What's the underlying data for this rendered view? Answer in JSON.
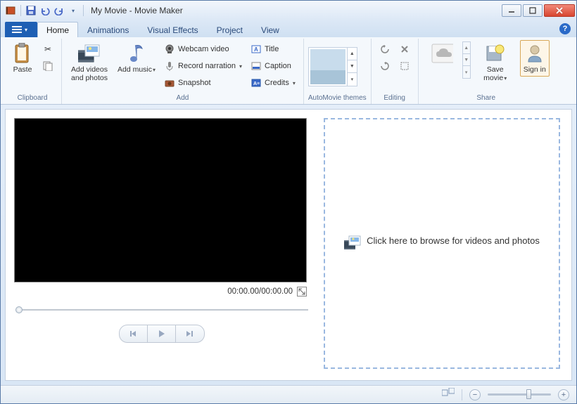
{
  "title": "My Movie - Movie Maker",
  "tabs": {
    "home": "Home",
    "animations": "Animations",
    "visual_effects": "Visual Effects",
    "project": "Project",
    "view": "View"
  },
  "ribbon": {
    "clipboard": {
      "paste": "Paste",
      "group_label": "Clipboard"
    },
    "add": {
      "add_videos": "Add videos and photos",
      "add_music": "Add music",
      "webcam": "Webcam video",
      "record_narration": "Record narration",
      "snapshot": "Snapshot",
      "title_btn": "Title",
      "caption": "Caption",
      "credits": "Credits",
      "group_label": "Add"
    },
    "automovie": {
      "group_label": "AutoMovie themes"
    },
    "editing": {
      "group_label": "Editing"
    },
    "share": {
      "save_movie": "Save movie",
      "sign_in": "Sign in",
      "group_label": "Share"
    }
  },
  "preview": {
    "time": "00:00.00/00:00.00"
  },
  "storyboard": {
    "hint": "Click here to browse for videos and photos"
  }
}
